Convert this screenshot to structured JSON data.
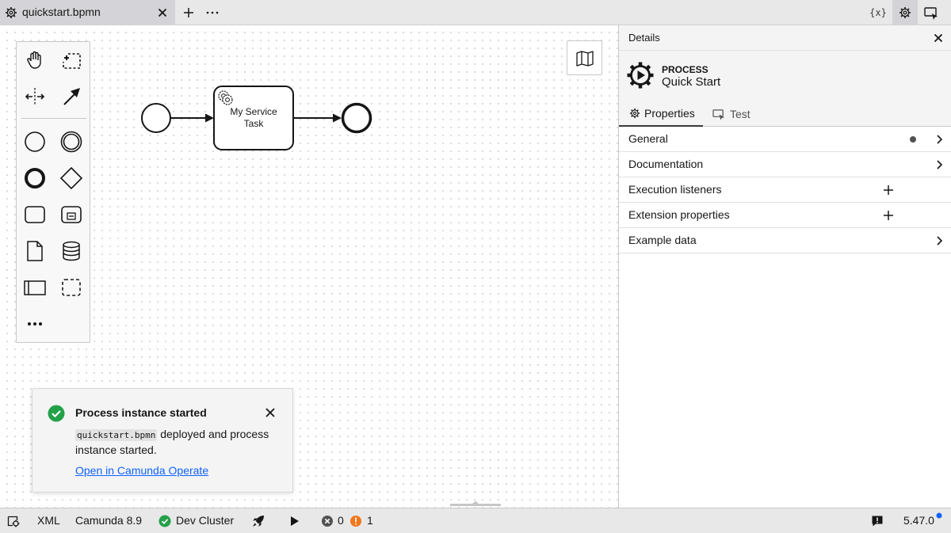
{
  "tab": {
    "filename": "quickstart.bpmn"
  },
  "topbar": {
    "variables_label": "{x}"
  },
  "diagram": {
    "service_task_line1": "My Service",
    "service_task_line2": "Task"
  },
  "toast": {
    "title": "Process instance started",
    "code": "quickstart.bpmn",
    "message_rest": " deployed and process instance started.",
    "link": "Open in Camunda Operate"
  },
  "panel": {
    "title": "Details",
    "element_type": "PROCESS",
    "element_name": "Quick Start",
    "tabs": [
      {
        "label": "Properties"
      },
      {
        "label": "Test"
      }
    ],
    "groups": [
      {
        "label": "General"
      },
      {
        "label": "Documentation"
      },
      {
        "label": "Execution listeners"
      },
      {
        "label": "Extension properties"
      },
      {
        "label": "Example data"
      }
    ]
  },
  "statusbar": {
    "xml": "XML",
    "engine": "Camunda 8.9",
    "cluster": "Dev Cluster",
    "errors": "0",
    "warnings": "1",
    "version": "5.47.0"
  },
  "colors": {
    "success": "#24a148",
    "warning": "#f1751a",
    "link": "#0f62fe",
    "error_icon": "#525252"
  }
}
